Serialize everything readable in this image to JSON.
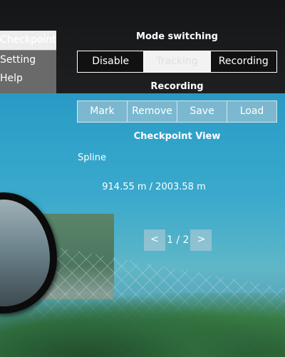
{
  "menu": {
    "items": [
      {
        "label": "Checkpoints",
        "active": true
      },
      {
        "label": "Setting",
        "active": false
      },
      {
        "label": "Help",
        "active": false
      }
    ]
  },
  "mode_switching": {
    "title": "Mode switching",
    "buttons": [
      {
        "label": "Disable",
        "active": false
      },
      {
        "label": "Tracking",
        "active": true
      },
      {
        "label": "Recording",
        "active": false
      }
    ]
  },
  "recording": {
    "title": "Recording",
    "buttons": [
      {
        "label": "Mark"
      },
      {
        "label": "Remove"
      },
      {
        "label": "Save"
      },
      {
        "label": "Load"
      }
    ]
  },
  "checkpoint_view": {
    "title": "Checkpoint View",
    "spline_label": "Spline",
    "distance": "914.55 m / 2003.58 m",
    "pager": {
      "prev": "<",
      "page": "1 / 2",
      "next": ">"
    }
  },
  "colors": {
    "panel_dark": "#1d1f21",
    "menu_gray": "#6a6a6a",
    "button_light": "#bfcdd7"
  }
}
